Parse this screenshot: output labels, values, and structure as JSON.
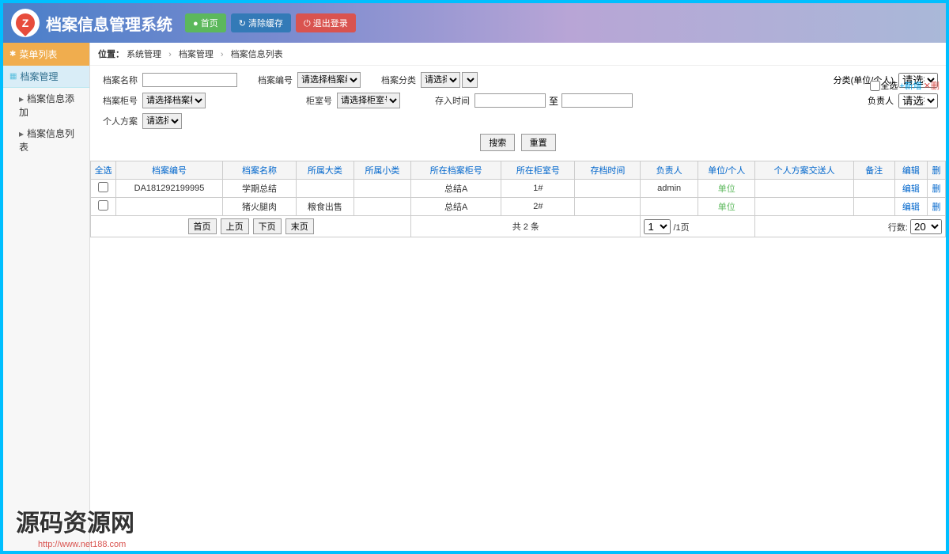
{
  "header": {
    "title": "档案信息管理系统",
    "home_btn": "● 首页",
    "clear_cache_btn": "↻ 清除缓存",
    "logout_btn": "⏻ 退出登录"
  },
  "sidebar": {
    "menu_header": "菜单列表",
    "group1": "档案管理",
    "items": [
      "档案信息添加",
      "档案信息列表"
    ]
  },
  "breadcrumb": {
    "prefix": "位置：",
    "parts": [
      "系统管理",
      "档案管理",
      "档案信息列表"
    ],
    "sep": "›"
  },
  "search": {
    "row1": {
      "f1_label": "档案名称",
      "f2_label": "档案编号",
      "f2_placeholder": "请选择档案编号",
      "f3_label": "档案分类",
      "f3_placeholder": "请选择",
      "f4_label": "分类(单位/个人)",
      "f4_placeholder": "请选择"
    },
    "row2": {
      "f1_label": "档案柜号",
      "f1_placeholder": "请选择档案柜号",
      "f2_label": "柜室号",
      "f2_placeholder": "请选择柜室号",
      "f3_label": "存入时间",
      "f3_to": "至",
      "f4_label": "负责人",
      "f4_placeholder": "请选择"
    },
    "row3": {
      "f1_label": "个人方案",
      "f1_placeholder": "请选择"
    },
    "search_btn": "搜索",
    "reset_btn": "重置"
  },
  "extra": {
    "select_all": "全选",
    "add": "+新增",
    "delete": "✕删"
  },
  "table": {
    "headers": [
      "全选",
      "档案编号",
      "档案名称",
      "所属大类",
      "所属小类",
      "所在档案柜号",
      "所在柜室号",
      "存档时间",
      "负责人",
      "单位/个人",
      "个人方案交送人",
      "备注",
      "编辑",
      "删"
    ],
    "rows": [
      {
        "check": "",
        "code": "DA181292199995",
        "name": "学期总结",
        "cat1": "",
        "cat2": "",
        "cabinet": "总结A",
        "room": "1#",
        "time": "",
        "person": "admin",
        "unit": "单位",
        "sender": "",
        "remark": "",
        "edit": "编辑",
        "del": "删"
      },
      {
        "check": "",
        "code": "",
        "name": "猪火腿肉",
        "cat1": "粮食出售",
        "cat2": "",
        "cabinet": "总结A",
        "room": "2#",
        "time": "",
        "person": "",
        "unit": "单位",
        "sender": "",
        "remark": "",
        "edit": "编辑",
        "del": "删"
      }
    ]
  },
  "pager": {
    "first": "首页",
    "prev": "上页",
    "next": "下页",
    "last": "末页",
    "total": "共 2 条",
    "page_select": "1",
    "page_suffix": "/1页",
    "rows_label": "行数:",
    "rows_select": "20"
  },
  "watermark": {
    "text": "源码资源网",
    "url": "http://www.net188.com"
  }
}
